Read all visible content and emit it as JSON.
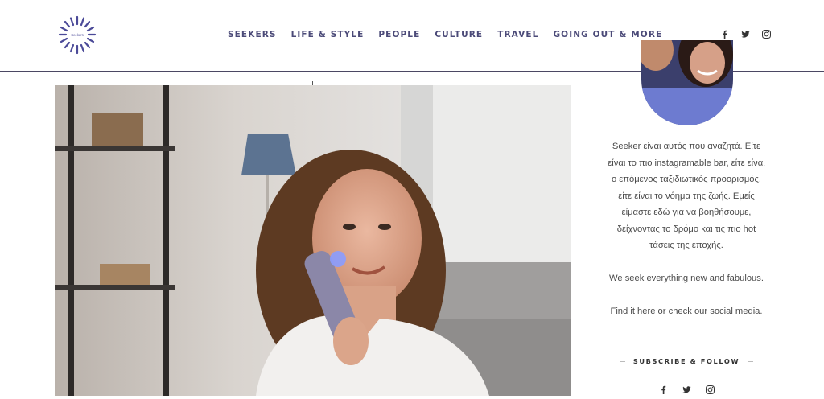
{
  "brand": {
    "logo_text": "Seekers"
  },
  "nav": [
    {
      "label": "SEEKERS"
    },
    {
      "label": "LIFE & STYLE"
    },
    {
      "label": "PEOPLE"
    },
    {
      "label": "CULTURE"
    },
    {
      "label": "TRAVEL"
    },
    {
      "label": "GOING OUT & MORE"
    }
  ],
  "header_social": [
    "facebook-icon",
    "twitter-icon",
    "instagram-icon"
  ],
  "sidebar": {
    "about_lines": [
      "Seeker είναι αυτός που αναζητά. Είτε",
      "είναι το πιο instagramable bar, είτε είναι",
      "ο επόμενος ταξιδιωτικός προορισμός,",
      "είτε είναι το νόημα της ζωής. Εμείς",
      "είμαστε εδώ για να βοηθήσουμε,",
      "δείχνοντας το δρόμο και τις πιο hot",
      "τάσεις της εποχής."
    ],
    "tagline": "We seek everything new and fabulous.",
    "cta": "Find it here or check our social media.",
    "subscribe_title": "SUBSCRIBE & FOLLOW",
    "social": [
      "facebook-icon",
      "twitter-icon",
      "instagram-icon"
    ]
  },
  "colors": {
    "nav": "#4b4a78",
    "accent": "#6b5fb0",
    "rule": "#4b4763"
  }
}
